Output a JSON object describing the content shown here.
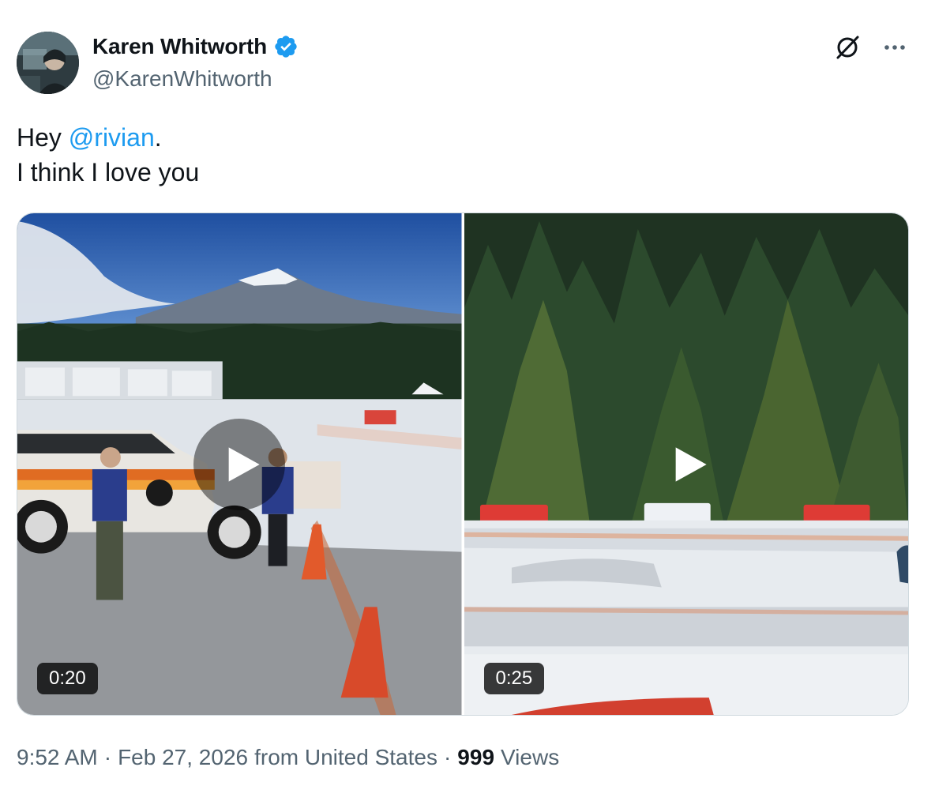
{
  "author": {
    "display_name": "Karen Whitworth",
    "handle": "@KarenWhitworth",
    "verified": true
  },
  "tweet": {
    "line1_prefix": "Hey ",
    "mention": "@rivian",
    "line1_suffix": ".",
    "line2": "I think I love you"
  },
  "media": [
    {
      "type": "video",
      "duration": "0:20"
    },
    {
      "type": "video",
      "duration": "0:25"
    }
  ],
  "meta": {
    "time": "9:52 AM",
    "separator": "·",
    "date": "Feb 27, 2026",
    "location": "from United States",
    "views_count": "999",
    "views_label": "Views"
  },
  "icons": {
    "verified": "verified-badge-icon",
    "grok": "grok-icon",
    "more": "more-icon",
    "play": "play-icon"
  },
  "colors": {
    "accent": "#1d9bf0",
    "text": "#0f1419",
    "secondary": "#536471"
  }
}
